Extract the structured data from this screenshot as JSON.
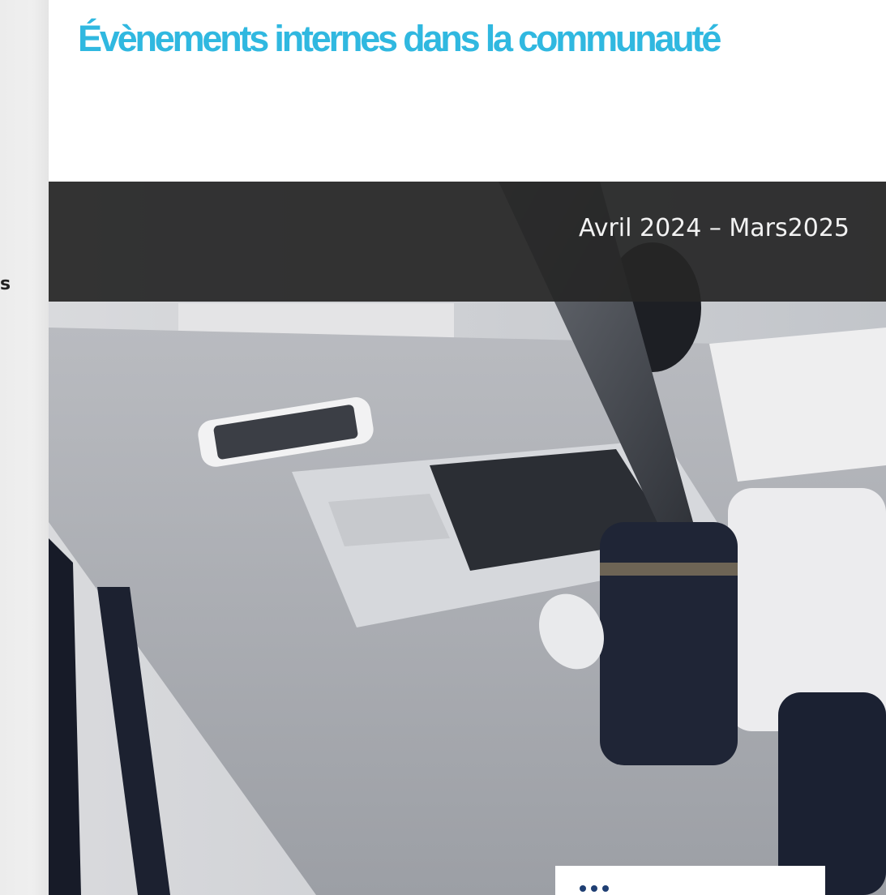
{
  "page": {
    "title": "Évènements internes dans la communauté",
    "period": "Avril 2024 – Mars2025",
    "side_letter": "s"
  },
  "colors": {
    "title": "#30b8e0",
    "band": "#262626",
    "period_text": "#f2f2f2"
  },
  "images": {
    "hero": "desk-with-laptop-phone-headphones-cups-photo"
  }
}
